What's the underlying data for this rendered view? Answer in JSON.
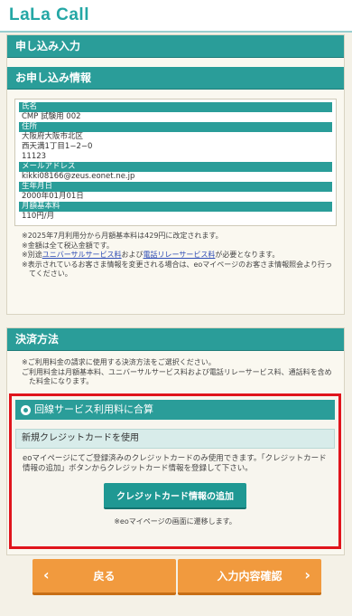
{
  "header": {
    "logo": "LaLa Call"
  },
  "form": {
    "section_title": "申し込み入力",
    "info_title": "お申し込み情報",
    "fields": [
      {
        "label": "氏名",
        "value": "CMP 試験用 002"
      },
      {
        "label": "住所",
        "value": "大阪府大阪市北区\n西天満1丁目1−2−0\n11123"
      },
      {
        "label": "メールアドレス",
        "value": "kikki08166@zeus.eonet.ne.jp"
      },
      {
        "label": "生年月日",
        "value": "2000年01月01日"
      },
      {
        "label": "月額基本料",
        "value": "110円/月"
      }
    ],
    "notes": {
      "n1": "※2025年7月利用分から月額基本料は429円に改定されます。",
      "n2": "※金額は全て税込金額です。",
      "n3_pre": "※別途",
      "n3_link1": "ユニバーサルサービス料",
      "n3_mid": "および",
      "n3_link2": "電話リレーサービス料",
      "n3_post": "が必要となります。",
      "n4": "※表示されているお客さま情報を変更される場合は、eoマイページのお客さま情報照会より行ってください。"
    }
  },
  "payment": {
    "title": "決済方法",
    "note1": "※ご利用料金の請求に使用する決済方法をご選択ください。",
    "note2": "ご利用料金は月額基本料、ユニバーサルサービス料および電話リレーサービス料、通話料を含めた料金になります。",
    "option_line": "回線サービス利用料に合算",
    "option_card": "新規クレジットカードを使用",
    "card_text": "eoマイページにてご登録済みのクレジットカードのみ使用できます。「クレジットカード情報の追加」ボタンからクレジットカード情報を登録して下さい。",
    "card_button": "クレジットカード情報の追加",
    "card_note": "※eoマイページの画面に遷移します。"
  },
  "buttons": {
    "back": "戻る",
    "confirm": "入力内容確認"
  },
  "colors": {
    "teal": "#2a9d99",
    "orange": "#f19a3e",
    "highlight_red": "#e0141c"
  }
}
